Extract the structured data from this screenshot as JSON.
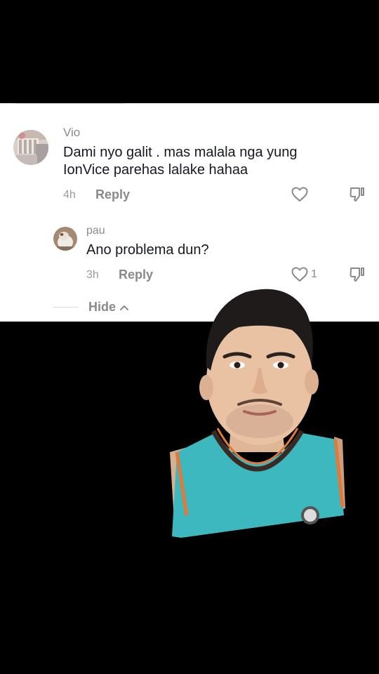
{
  "comments": [
    {
      "username": "Vio",
      "text_line1": "Dami nyo galit . mas malala nga yung",
      "text_line2": "IonVice parehas lalake hahaa",
      "time": "4h",
      "reply_label": "Reply",
      "like_count": ""
    }
  ],
  "reply": {
    "username": "pau",
    "text": "Ano problema dun?",
    "time": "3h",
    "reply_label": "Reply",
    "like_count": "1"
  },
  "hide_label": "Hide",
  "icons": {
    "like": "heart-outline-icon",
    "dislike": "thumbs-down-icon",
    "hide": "chevron-up-icon"
  },
  "colors": {
    "card_bg": "#ffffff",
    "page_bg": "#000000",
    "text_primary": "#161823",
    "text_secondary": "#8a8a8a",
    "jersey": "#3cb8be"
  }
}
